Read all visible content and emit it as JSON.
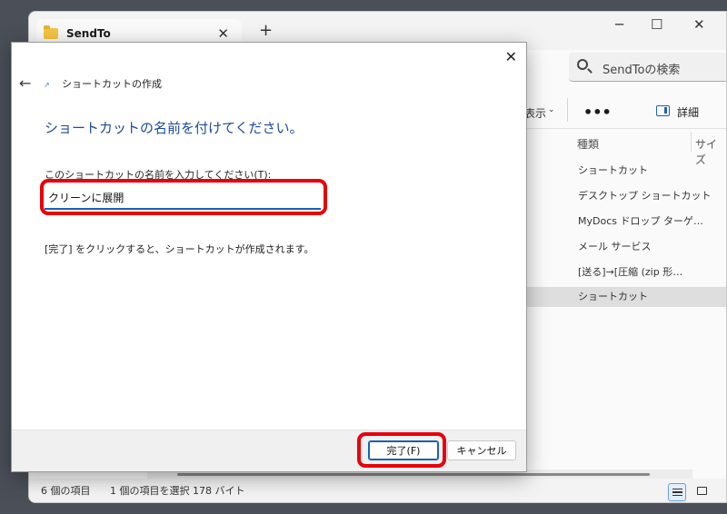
{
  "explorer": {
    "tab_title": "SendTo",
    "search_placeholder": "SendToの検索",
    "toolbar": {
      "view_label": "表示",
      "more_label": "•••",
      "details_label": "詳細"
    },
    "columns": [
      "種類",
      "サイズ"
    ],
    "rows": [
      {
        "type": "ショートカット",
        "selected": false
      },
      {
        "type": "デスクトップ ショートカット",
        "selected": false
      },
      {
        "type": "MyDocs ドロップ ターゲ…",
        "selected": false
      },
      {
        "type": "メール サービス",
        "selected": false
      },
      {
        "type": "[送る]→[圧縮 (zip 形…",
        "selected": false
      },
      {
        "type": "ショートカット",
        "selected": true
      }
    ],
    "status": {
      "item_count": "6 個の項目",
      "selection": "1 個の項目を選択  178 バイト"
    }
  },
  "dialog": {
    "title": "ショートカットの作成",
    "heading": "ショートカットの名前を付けてください。",
    "field_label": "このショートカットの名前を入力してください(T):",
    "name_value": "クリーンに展開",
    "hint": "[完了] をクリックすると、ショートカットが作成されます。",
    "finish_label": "完了(F)",
    "cancel_label": "キャンセル"
  },
  "colors": {
    "highlight": "#e8000b",
    "accent": "#1a5fb8",
    "heading": "#1a4a9c"
  }
}
